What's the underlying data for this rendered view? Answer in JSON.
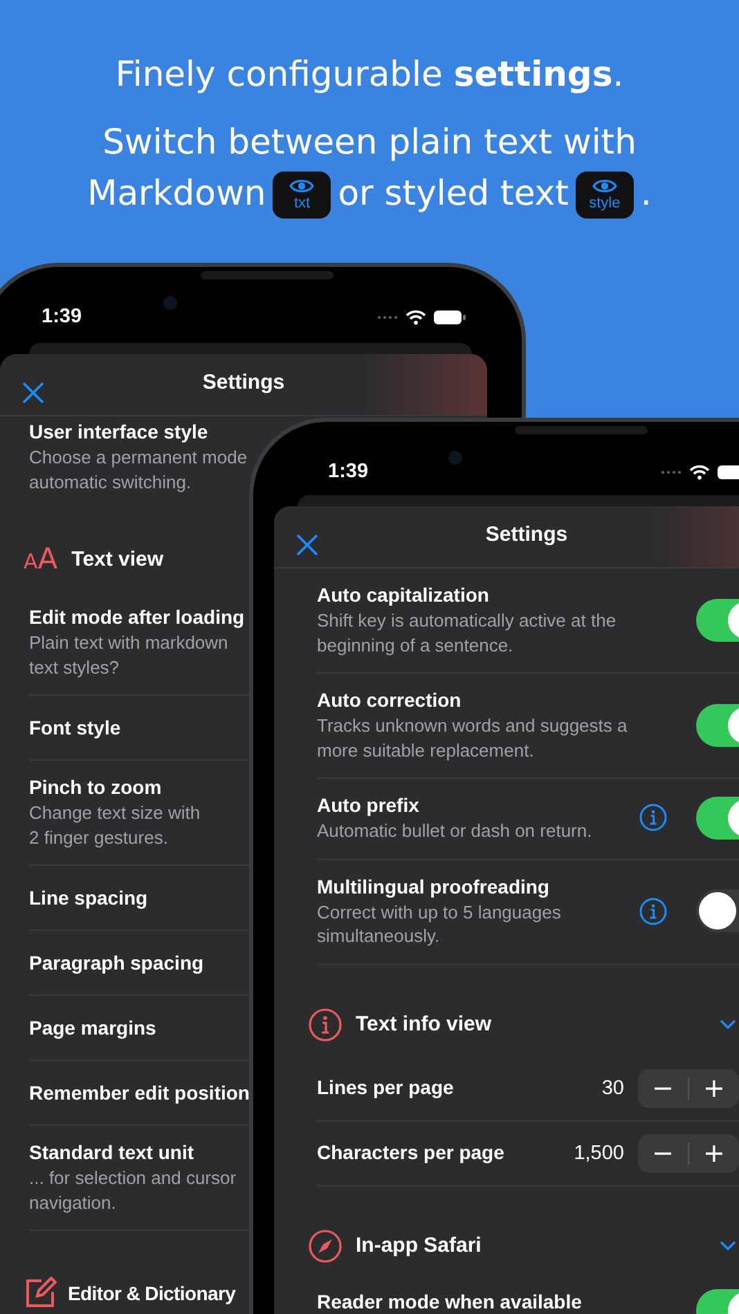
{
  "headline": "Finely configurable **settings**.",
  "subline": [
    {
      "kind": "line",
      "text": "Switch between plain text with"
    },
    {
      "kind": "text",
      "text": "Markdown"
    },
    {
      "kind": "badge",
      "text": "txt"
    },
    {
      "kind": "text",
      "text": "or styled text"
    },
    {
      "kind": "badge",
      "text": "style"
    },
    {
      "kind": "text",
      "text": "."
    }
  ],
  "back_phone": {
    "time": "1:39",
    "title": "Settings",
    "rows": [
      {
        "kind": "row",
        "title": "User interface style",
        "description": [
          "Choose a permanent mode",
          "automatic switching."
        ]
      },
      {
        "kind": "letters",
        "glyphs": "AA",
        "title": "Text view"
      },
      {
        "kind": "row",
        "title": "Edit mode after loading",
        "description": [
          "Plain text with markdown",
          "text styles?"
        ]
      },
      {
        "kind": "row",
        "title": "Font style"
      },
      {
        "kind": "row",
        "title": "Pinch to zoom",
        "description": [
          "Change text size with",
          "2 finger gestures."
        ]
      },
      {
        "kind": "row",
        "title": "Line spacing"
      },
      {
        "kind": "row",
        "title": "Paragraph spacing"
      },
      {
        "kind": "row",
        "title": "Page margins"
      },
      {
        "kind": "row",
        "title": "Remember edit position"
      },
      {
        "kind": "row",
        "title": "Standard text unit",
        "description": [
          "... for selection and cursor",
          "navigation."
        ]
      },
      {
        "kind": "edit",
        "title": "Editor & Dictionary"
      }
    ]
  },
  "front_phone": {
    "time": "1:39",
    "title": "Settings",
    "rows": [
      {
        "kind": "toggle",
        "title": "Auto capitalization",
        "description": [
          "Shift key is automatically active at the",
          "beginning of a sentence."
        ],
        "info": false,
        "on": true
      },
      {
        "kind": "toggle",
        "title": "Auto correction",
        "description": [
          "Tracks unknown words and suggests a",
          "more suitable replacement."
        ],
        "info": false,
        "on": true
      },
      {
        "kind": "toggle",
        "title": "Auto prefix",
        "description": [
          "Automatic bullet or dash on return."
        ],
        "info": true,
        "on": true
      },
      {
        "kind": "toggle",
        "title": "Multilingual proofreading",
        "description": [
          "Correct with up to 5 languages",
          "simultaneously."
        ],
        "info": true,
        "on": false
      },
      {
        "kind": "info",
        "title": "Text info view"
      },
      {
        "kind": "stepper",
        "title": "Lines per page",
        "value": "30",
        "minus": "−",
        "plus": "+"
      },
      {
        "kind": "stepper",
        "title": "Characters per page",
        "value": "1,500",
        "minus": "−",
        "plus": "+"
      },
      {
        "kind": "compass",
        "title": "In-app Safari"
      },
      {
        "kind": "toggle",
        "title": "Reader mode when available",
        "info": false,
        "on": true
      }
    ]
  }
}
